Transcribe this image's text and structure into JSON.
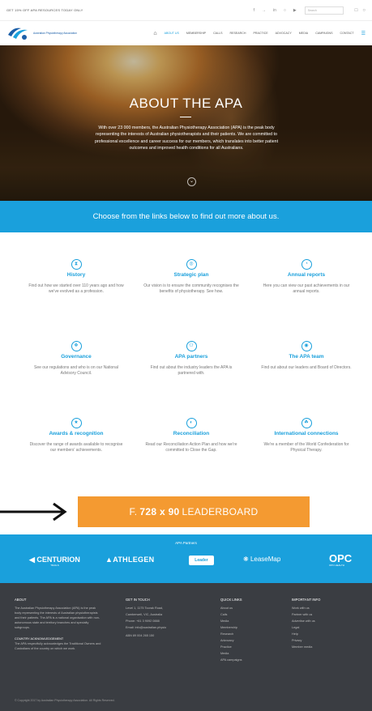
{
  "topbar": {
    "promo": "GET 15% OFF APA RESOURCES TODAY ONLY",
    "social": [
      "f",
      "→",
      "in",
      "○",
      "▶"
    ],
    "search_placeholder": "Search",
    "icons": [
      "cart-icon",
      "user-icon"
    ]
  },
  "nav": {
    "logo_text": "Australian Physiotherapy Association",
    "items": [
      "ABOUT US",
      "MEMBERSHIP",
      "CALLS",
      "RESEARCH",
      "PRACTICE",
      "ADVOCACY",
      "MEDIA",
      "CAMPAIGNS",
      "CONTACT"
    ]
  },
  "hero": {
    "title": "ABOUT THE APA",
    "text": "With over 23 000 members, the Australian Physiotherapy Association (APA) is the peak body representing the interests of Australian physiotherapists and their patients. We are committed to professional excellence and career success for our members, which translates into better patient outcomes and improved health conditions for all Australians."
  },
  "band": {
    "text": "Choose from the links below to find out more about us."
  },
  "tiles": [
    {
      "icon": "⧗",
      "title": "History",
      "desc": "Find out how we started over 110 years ago and how we've evolved as a profession."
    },
    {
      "icon": "◎",
      "title": "Strategic plan",
      "desc": "Our vision is to ensure the community recognises the benefits of physiotherapy. See how."
    },
    {
      "icon": "◔",
      "title": "Annual reports",
      "desc": "Here you can view our past achievements in our annual reports."
    },
    {
      "icon": "❖",
      "title": "Governance",
      "desc": "See our regulations and who is on our National Advisory Council."
    },
    {
      "icon": "⚇",
      "title": "APA partners",
      "desc": "Find out about the industry leaders the APA is partnered with."
    },
    {
      "icon": "◉",
      "title": "The APA team",
      "desc": "Find out about our leaders and Board of Directors."
    },
    {
      "icon": "★",
      "title": "Awards & recognition",
      "desc": "Discover the range of awards available to recognise our members' achievements."
    },
    {
      "icon": "◐",
      "title": "Reconciliation",
      "desc": "Read our Reconciliation Action Plan and how we're committed to Close the Gap."
    },
    {
      "icon": "☘",
      "title": "International connections",
      "desc": "We're a member of the World Confederation for Physical Therapy."
    }
  ],
  "leaderboard": {
    "prefix": "F.",
    "size": "728 x 90",
    "label": "LEADERBOARD"
  },
  "partners": {
    "label": "APA Partners",
    "centurion": "CENTURION",
    "centurion_sub": "TRAILS",
    "athlegen": "ATHLEGEN",
    "leader": "Leader",
    "leasemap": "LeaseMap",
    "opc": "OPC",
    "opc_sub": "OPC HEALTH"
  },
  "footer": {
    "about_h": "ABOUT",
    "about_text": "The Australian Physiotherapy Association (APA) is the peak body representing the interests of Australian physiotherapists and their patients. The APA is a national organisation with non-autonomous state and territory branches and specialty subgroups.",
    "ack_h": "COUNTRY ACKNOWLEDGEMENT",
    "ack_text": "The APA respectfully acknowledges the Traditional Owners and Custodians of the country on which we work.",
    "touch_h": "GET IN TOUCH",
    "touch": [
      "Level 1, 1175 Toorak Road,",
      "Camberwell, VIC, Australia",
      "Phone: +61 3 9092 0888",
      "Email: info@australian.physio",
      "ABN 89 004 265 150"
    ],
    "quick_h": "QUICK LINKS",
    "quick": [
      "About us",
      "Calls",
      "Media",
      "Membership",
      "Research",
      "Advocacy",
      "Practice",
      "Media",
      "APA campaigns"
    ],
    "info_h": "IMPORTANT INFO",
    "info": [
      "Work with us",
      "Partner with us",
      "Advertise with us",
      "Legal",
      "Help",
      "Privacy",
      "Member media"
    ],
    "copyright": "© Copyright 2017 by Australian Physiotherapy Association. All Rights Reserved."
  }
}
